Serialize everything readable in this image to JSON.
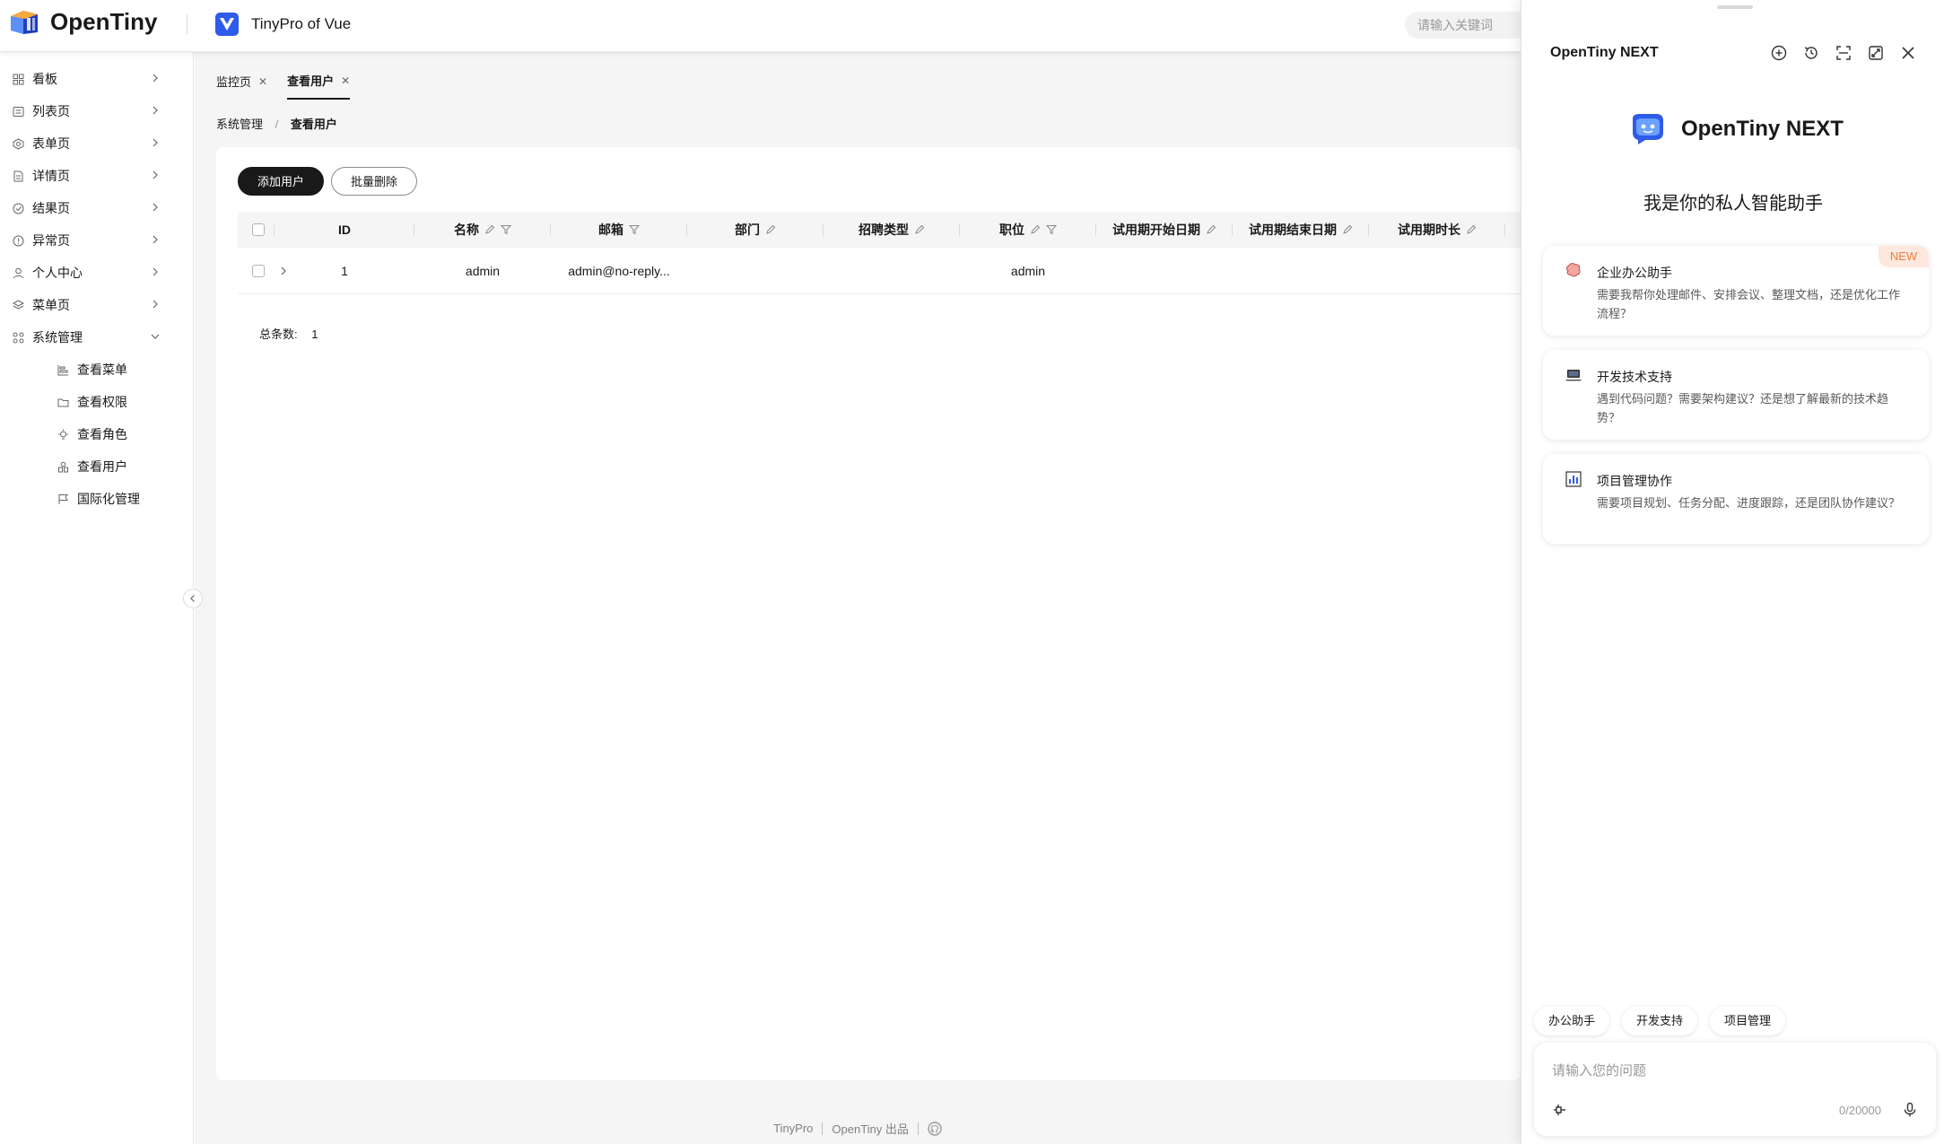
{
  "header": {
    "logo_text": "OpenTiny",
    "app_name": "TinyPro of Vue",
    "search_placeholder": "请输入关键词"
  },
  "sidebar": {
    "items": [
      {
        "label": "看板",
        "icon": "dashboard-icon"
      },
      {
        "label": "列表页",
        "icon": "list-icon"
      },
      {
        "label": "表单页",
        "icon": "form-icon"
      },
      {
        "label": "详情页",
        "icon": "detail-icon"
      },
      {
        "label": "结果页",
        "icon": "result-icon"
      },
      {
        "label": "异常页",
        "icon": "exception-icon"
      },
      {
        "label": "个人中心",
        "icon": "user-icon"
      },
      {
        "label": "菜单页",
        "icon": "menu-icon"
      },
      {
        "label": "系统管理",
        "icon": "system-icon"
      }
    ],
    "sub_items": [
      {
        "label": "查看菜单",
        "icon": "menu-tree-icon"
      },
      {
        "label": "查看权限",
        "icon": "folder-icon"
      },
      {
        "label": "查看角色",
        "icon": "bulb-icon"
      },
      {
        "label": "查看用户",
        "icon": "users-icon"
      },
      {
        "label": "国际化管理",
        "icon": "flag-icon"
      }
    ]
  },
  "tabs": [
    {
      "label": "监控页"
    },
    {
      "label": "查看用户"
    }
  ],
  "breadcrumb": {
    "parent": "系统管理",
    "sep": "/",
    "current": "查看用户"
  },
  "toolbar": {
    "add_label": "添加用户",
    "batch_delete_label": "批量删除"
  },
  "table": {
    "columns": [
      "ID",
      "名称",
      "邮箱",
      "部门",
      "招聘类型",
      "职位",
      "试用期开始日期",
      "试用期结束日期",
      "试用期时长"
    ],
    "rows": [
      {
        "id": "1",
        "name": "admin",
        "email": "admin@no-reply...",
        "dept": "",
        "type": "",
        "position": "admin",
        "start": "",
        "end": "",
        "duration": ""
      }
    ],
    "total_label": "总条数:",
    "total_value": "1"
  },
  "footer": {
    "brand": "TinyPro",
    "maker": "OpenTiny 出品"
  },
  "assistant": {
    "title": "OpenTiny NEXT",
    "brand_name": "OpenTiny NEXT",
    "welcome": "我是你的私人智能助手",
    "cards": [
      {
        "title": "企业办公助手",
        "desc": "需要我帮你处理邮件、安排会议、整理文档，还是优化工作流程？",
        "icon": "brain-icon",
        "badge": "NEW"
      },
      {
        "title": "开发技术支持",
        "desc": "遇到代码问题？需要架构建议？还是想了解最新的技术趋势？",
        "icon": "laptop-icon",
        "badge": ""
      },
      {
        "title": "项目管理协作",
        "desc": "需要项目规划、任务分配、进度跟踪，还是团队协作建议？",
        "icon": "chart-icon",
        "badge": ""
      }
    ],
    "chips": [
      "办公助手",
      "开发支持",
      "项目管理"
    ],
    "input_placeholder": "请输入您的问题",
    "char_count": "0/20000"
  },
  "colors": {
    "primary": "#191919",
    "accent_blue": "#2f5bea",
    "badge_bg": "#fde8dd",
    "badge_text": "#ef7c3a"
  }
}
